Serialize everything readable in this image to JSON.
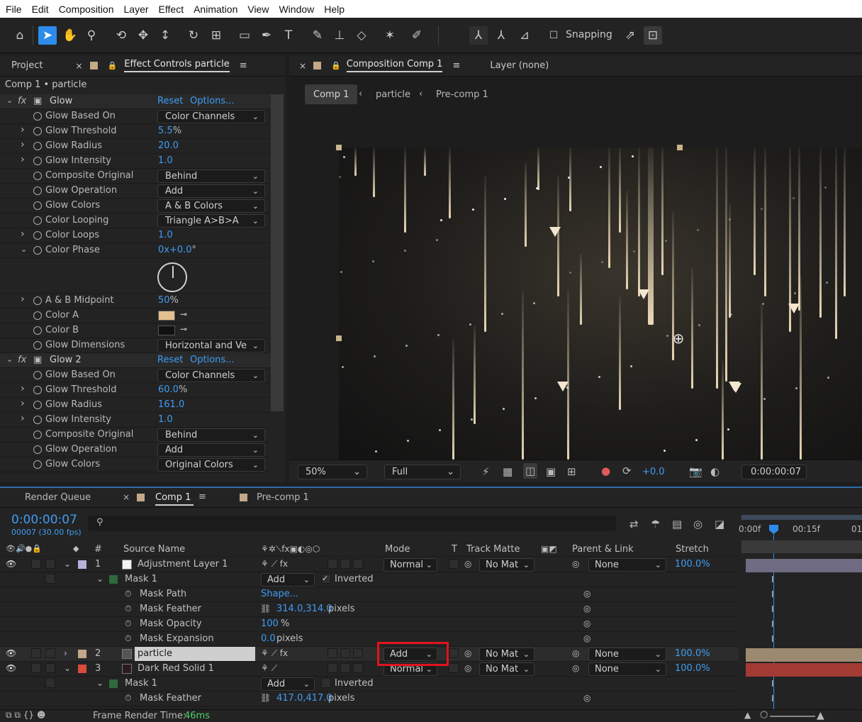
{
  "menu": [
    "File",
    "Edit",
    "Composition",
    "Layer",
    "Effect",
    "Animation",
    "View",
    "Window",
    "Help"
  ],
  "toolbar": {
    "snapping_label": "Snapping",
    "icons": [
      "home-icon",
      "selection-tool-icon",
      "hand-tool-icon",
      "zoom-tool-icon",
      "orbit-camera-icon",
      "pan-camera-icon",
      "dolly-camera-icon",
      "rotation-tool-icon",
      "pan-behind-icon",
      "rectangle-tool-icon",
      "pen-tool-icon",
      "type-tool-icon",
      "brush-tool-icon",
      "clone-stamp-icon",
      "eraser-icon",
      "roto-brush-icon",
      "puppet-pin-icon"
    ]
  },
  "left_panel": {
    "tab_project": "Project",
    "tab_effect_controls": "Effect Controls particle",
    "breadcrumb": "Comp 1 • particle",
    "effects": [
      {
        "name": "Glow",
        "reset": "Reset",
        "options": "Options...",
        "props": [
          {
            "label": "Glow Based On",
            "type": "drop",
            "value": "Color Channels"
          },
          {
            "label": "Glow Threshold",
            "type": "num",
            "value": "5.5",
            "unit": "%"
          },
          {
            "label": "Glow Radius",
            "type": "num",
            "value": "20.0",
            "unit": ""
          },
          {
            "label": "Glow Intensity",
            "type": "num",
            "value": "1.0",
            "unit": ""
          },
          {
            "label": "Composite Original",
            "type": "drop",
            "value": "Behind"
          },
          {
            "label": "Glow Operation",
            "type": "drop",
            "value": "Add"
          },
          {
            "label": "Glow Colors",
            "type": "drop",
            "value": "A & B Colors"
          },
          {
            "label": "Color Looping",
            "type": "drop",
            "value": "Triangle A>B>A"
          },
          {
            "label": "Color Loops",
            "type": "num",
            "value": "1.0",
            "unit": ""
          },
          {
            "label": "Color Phase",
            "type": "num",
            "value": "0x+0.0",
            "unit": "°"
          },
          {
            "label": "A & B Midpoint",
            "type": "num",
            "value": "50",
            "unit": "%"
          },
          {
            "label": "Color A",
            "type": "color",
            "value": "#e3c08e"
          },
          {
            "label": "Color B",
            "type": "color",
            "value": "#111111"
          },
          {
            "label": "Glow Dimensions",
            "type": "drop",
            "value": "Horizontal and Ve"
          }
        ]
      },
      {
        "name": "Glow 2",
        "reset": "Reset",
        "options": "Options...",
        "props": [
          {
            "label": "Glow Based On",
            "type": "drop",
            "value": "Color Channels"
          },
          {
            "label": "Glow Threshold",
            "type": "num",
            "value": "60.0",
            "unit": "%"
          },
          {
            "label": "Glow Radius",
            "type": "num",
            "value": "161.0",
            "unit": ""
          },
          {
            "label": "Glow Intensity",
            "type": "num",
            "value": "1.0",
            "unit": ""
          },
          {
            "label": "Composite Original",
            "type": "drop",
            "value": "Behind"
          },
          {
            "label": "Glow Operation",
            "type": "drop",
            "value": "Add"
          },
          {
            "label": "Glow Colors",
            "type": "drop",
            "value": "Original Colors"
          }
        ]
      }
    ]
  },
  "comp_panel": {
    "tab_composition": "Composition Comp 1",
    "tab_layer": "Layer (none)",
    "crumbs": [
      "Comp 1",
      "particle",
      "Pre-comp 1"
    ],
    "zoom": "50%",
    "resolution": "Full",
    "exposure": "+0.0",
    "timecode": "0:00:00:07"
  },
  "timeline": {
    "tabs": [
      "Render Queue",
      "Comp 1",
      "Pre-comp 1"
    ],
    "current_time": "0:00:00:07",
    "frame_info": "00007 (30.00 fps)",
    "ruler": [
      "0:00f",
      "00:15f",
      "01"
    ],
    "columns": {
      "source_name": "Source Name",
      "mode": "Mode",
      "t": "T",
      "track_matte": "Track Matte",
      "parent": "Parent & Link",
      "stretch": "Stretch",
      "num": "#"
    },
    "layers": [
      {
        "num": "1",
        "name": "Adjustment Layer 1",
        "mode": "Normal",
        "matte": "No Mat",
        "parent": "None",
        "stretch": "100.0%",
        "label_color": "#b6b0dc"
      },
      {
        "num": "2",
        "name": "particle",
        "mode": "Add",
        "matte": "No Mat",
        "parent": "None",
        "stretch": "100.0%",
        "label_color": "#c4a887"
      },
      {
        "num": "3",
        "name": "Dark Red Solid 1",
        "mode": "Normal",
        "matte": "No Mat",
        "parent": "None",
        "stretch": "100.0%",
        "label_color": "#d94a3a"
      }
    ],
    "mask1": {
      "name": "Mask 1",
      "mode": "Add",
      "inverted": "Inverted",
      "path_label": "Mask Path",
      "path_value": "Shape...",
      "feather_label": "Mask Feather",
      "feather_value": "314.0,314.0",
      "feather_unit": "pixels",
      "opacity_label": "Mask Opacity",
      "opacity_value": "100",
      "opacity_unit": "%",
      "expansion_label": "Mask Expansion",
      "expansion_value": "0.0",
      "expansion_unit": "pixels"
    },
    "mask3": {
      "name": "Mask 1",
      "mode": "Add",
      "inverted": "Inverted",
      "feather_label": "Mask Feather",
      "feather_value": "417.0,417.0",
      "feather_unit": "pixels"
    },
    "footer": {
      "label": "Frame Render Time:",
      "value": "46ms"
    }
  },
  "colors": {
    "accent": "#2d8ceb",
    "value_blue": "#3f9cf4",
    "highlight_box": "#e0141e"
  }
}
